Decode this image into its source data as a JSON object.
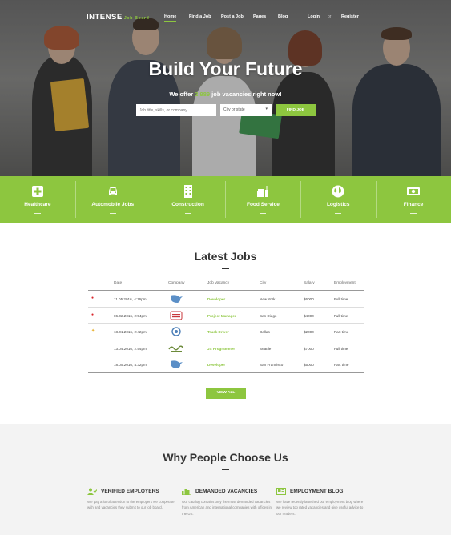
{
  "colors": {
    "accent": "#8dc63f",
    "text": "#333333",
    "muted": "#888888"
  },
  "nav": {
    "logo": "INTENSE",
    "logo_sub": "Job Board",
    "items": [
      "Home",
      "Find a Job",
      "Post a Job",
      "Pages",
      "Blog"
    ],
    "active": "Home",
    "login": "Login",
    "or": "or",
    "register": "Register"
  },
  "hero": {
    "title": "Build Your Future",
    "sub_before": "We offer",
    "count": "2,989",
    "sub_after": "job vacancies right now!",
    "search_placeholder": "Job title, skills, or company",
    "city_placeholder": "City or state",
    "find_label": "FIND JOB"
  },
  "categories": [
    {
      "label": "Healthcare",
      "icon": "medical-cross-icon"
    },
    {
      "label": "Automobile Jobs",
      "icon": "car-icon"
    },
    {
      "label": "Construction",
      "icon": "building-icon"
    },
    {
      "label": "Food Service",
      "icon": "food-icon"
    },
    {
      "label": "Logistics",
      "icon": "globe-icon"
    },
    {
      "label": "Finance",
      "icon": "money-icon"
    }
  ],
  "latest": {
    "title": "Latest Jobs",
    "columns": [
      "Date",
      "Company",
      "Job Vacancy",
      "City",
      "Salary",
      "Employment"
    ],
    "rows": [
      {
        "date": "11.05.2016, 4:16pm",
        "position": "Developer",
        "city": "New York",
        "salary": "$6000",
        "employment": "Full time",
        "mark": "hot",
        "logo": "blue-bird-logo"
      },
      {
        "date": "06.02.2016, 2:54pm",
        "position": "Project Manager",
        "city": "San Diego",
        "salary": "$4000",
        "employment": "Full time",
        "mark": "hot",
        "logo": "red-badge-logo"
      },
      {
        "date": "18.01.2016, 2:42pm",
        "position": "Truck Driver",
        "city": "Dallas",
        "salary": "$2000",
        "employment": "Part time",
        "mark": "featured",
        "logo": "blue-circle-logo"
      },
      {
        "date": "13.04.2016, 2:54pm",
        "position": "JS Programmer",
        "city": "Seattle",
        "salary": "$7000",
        "employment": "Full time",
        "mark": "",
        "logo": "green-script-logo"
      },
      {
        "date": "18.05.2016, 4:32pm",
        "position": "Developer",
        "city": "San Francisco",
        "salary": "$5000",
        "employment": "Part time",
        "mark": "",
        "logo": "blue-bird-logo"
      }
    ],
    "view_all": "VIEW ALL"
  },
  "why": {
    "title": "Why People Choose Us",
    "features": [
      {
        "title": "VERIFIED EMPLOYERS",
        "icon": "user-check-icon",
        "text": "We pay a lot of attention to the employers we cooperate with and vacancies they submit to our job board."
      },
      {
        "title": "DEMANDED VACANCIES",
        "icon": "bar-chart-icon",
        "text": "Our catalog contains only the most demanded vacancies from American and international companies with offices in the US."
      },
      {
        "title": "EMPLOYMENT BLOG",
        "icon": "newspaper-icon",
        "text": "We have recently launched our employment blog where we review top rated vacancies and give useful advice to our readers."
      }
    ]
  }
}
